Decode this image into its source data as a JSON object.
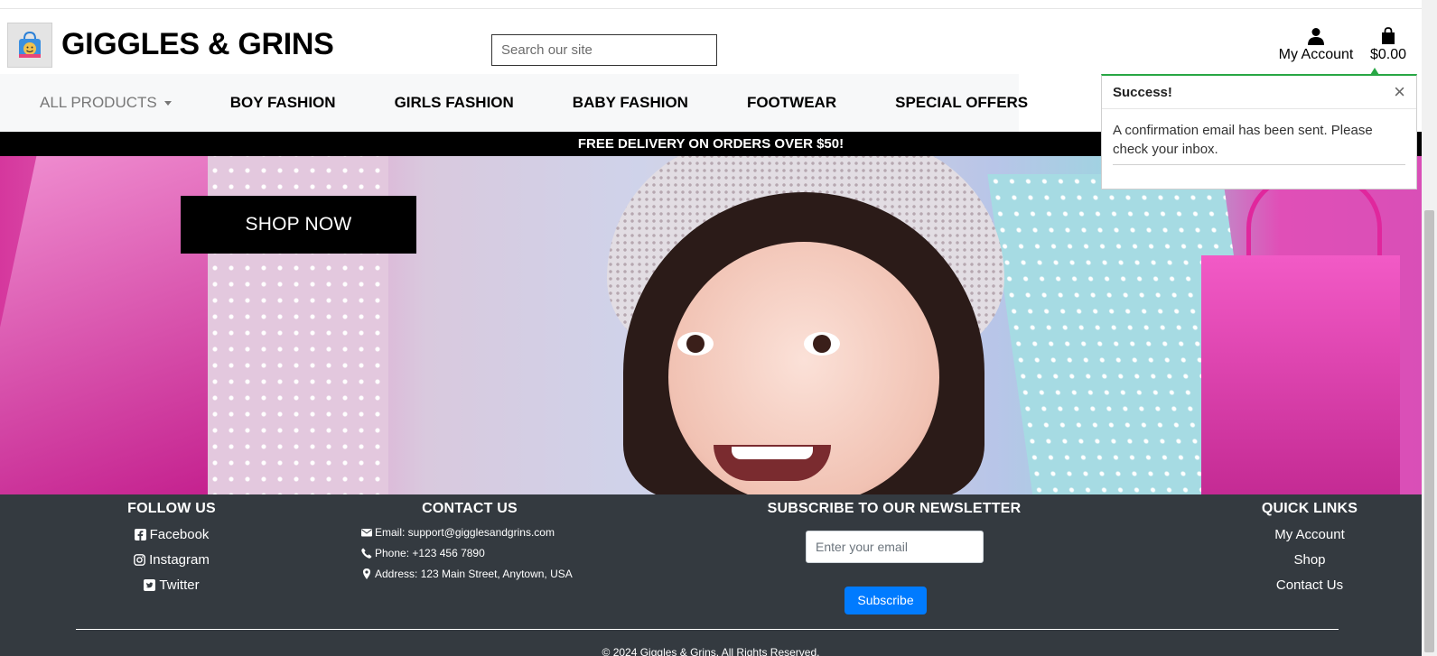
{
  "header": {
    "brand": "GIGGLES & GRINS",
    "search_placeholder": "Search our site",
    "account_label": "My Account",
    "cart_total": "$0.00"
  },
  "nav": {
    "items": [
      {
        "label": "ALL PRODUCTS"
      },
      {
        "label": "BOY FASHION"
      },
      {
        "label": "GIRLS FASHION"
      },
      {
        "label": "BABY FASHION"
      },
      {
        "label": "FOOTWEAR"
      },
      {
        "label": "SPECIAL OFFERS"
      }
    ]
  },
  "promo": {
    "text": "FREE DELIVERY ON ORDERS OVER $50!"
  },
  "hero": {
    "cta": "SHOP NOW"
  },
  "toast": {
    "title": "Success!",
    "close": "×",
    "message": "A confirmation email has been sent. Please check your inbox.",
    "accent_color": "#28a745"
  },
  "footer": {
    "follow": {
      "heading": "FOLLOW US",
      "links": [
        {
          "label": "Facebook",
          "icon": "facebook-icon"
        },
        {
          "label": "Instagram",
          "icon": "instagram-icon"
        },
        {
          "label": "Twitter",
          "icon": "twitter-icon"
        }
      ]
    },
    "contact": {
      "heading": "CONTACT US",
      "email": "Email: support@gigglesandgrins.com",
      "phone": "Phone: +123 456 7890",
      "address": "Address: 123 Main Street, Anytown, USA"
    },
    "newsletter": {
      "heading": "SUBSCRIBE TO OUR NEWSLETTER",
      "placeholder": "Enter your email",
      "button": "Subscribe",
      "button_color": "#007bff"
    },
    "quick_links": {
      "heading": "QUICK LINKS",
      "links": [
        "My Account",
        "Shop",
        "Contact Us"
      ]
    },
    "copyright": "© 2024 Giggles & Grins. All Rights Reserved.",
    "background": "#343a40"
  }
}
